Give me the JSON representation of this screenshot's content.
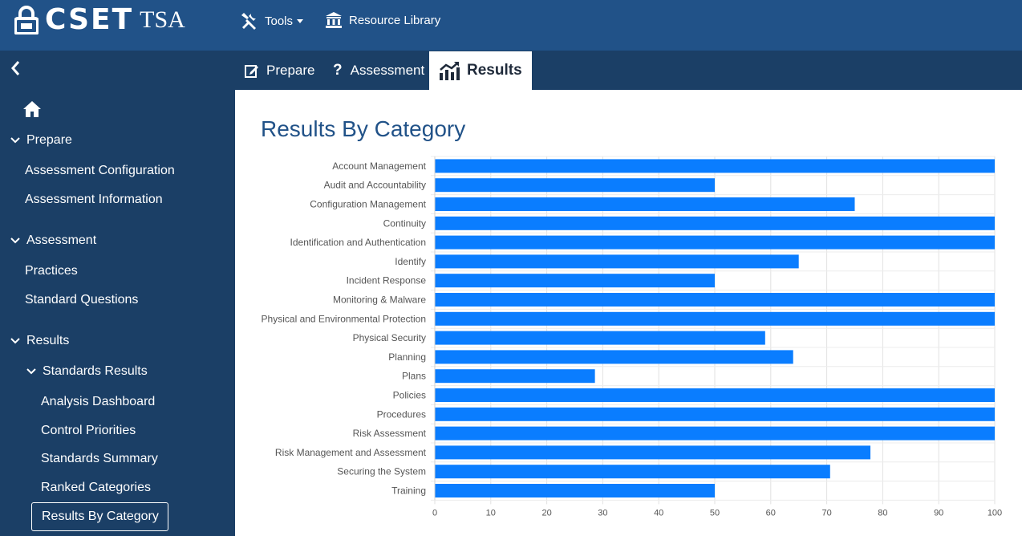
{
  "header": {
    "logo_text": "CSET",
    "logo_suffix": "TSA",
    "tools_label": "Tools",
    "library_label": "Resource Library"
  },
  "tabs": {
    "prepare": "Prepare",
    "assessment": "Assessment",
    "results": "Results"
  },
  "sidebar": {
    "prepare_head": "Prepare",
    "assessment_config": "Assessment Configuration",
    "assessment_info": "Assessment Information",
    "assessment_head": "Assessment",
    "practices": "Practices",
    "standard_questions": "Standard Questions",
    "results_head": "Results",
    "standards_results": "Standards Results",
    "analysis_dashboard": "Analysis Dashboard",
    "control_priorities": "Control Priorities",
    "standards_summary": "Standards Summary",
    "ranked_categories": "Ranked Categories",
    "results_by_category": "Results By Category"
  },
  "colors": {
    "brand": "#215288",
    "nav_dark": "#1b3f66",
    "bar": "#0a7dff"
  },
  "page": {
    "title": "Results By Category"
  },
  "chart_data": {
    "type": "bar",
    "orientation": "horizontal",
    "categories": [
      "Account Management",
      "Audit and Accountability",
      "Configuration Management",
      "Continuity",
      "Identification and Authentication",
      "Identify",
      "Incident Response",
      "Monitoring & Malware",
      "Physical and Environmental Protection",
      "Physical Security",
      "Planning",
      "Plans",
      "Policies",
      "Procedures",
      "Risk Assessment",
      "Risk Management and Assessment",
      "Securing the System",
      "Training"
    ],
    "values": [
      100,
      50,
      75,
      100,
      100,
      65,
      50,
      100,
      100,
      59,
      64,
      28.6,
      100,
      100,
      100,
      77.8,
      70.6,
      50
    ],
    "ticks": [
      0,
      10,
      20,
      30,
      40,
      50,
      60,
      70,
      80,
      90,
      100
    ],
    "xlim": [
      0,
      100
    ],
    "grid": true
  }
}
